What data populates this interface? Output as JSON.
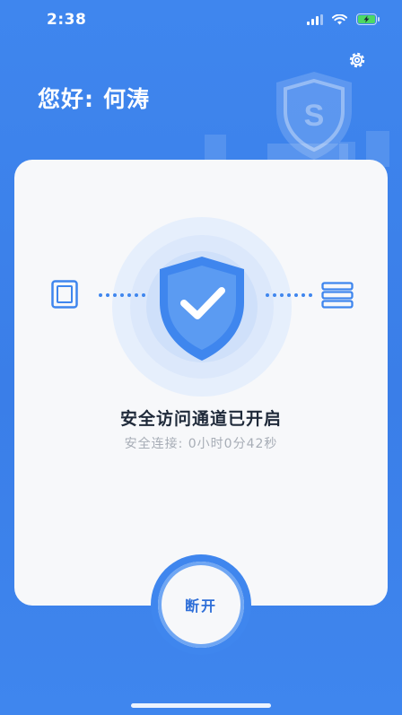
{
  "status_bar": {
    "time": "2:38"
  },
  "header": {
    "greeting": "您好:",
    "user_name": "何涛"
  },
  "icons": {
    "settings": "gear-icon",
    "brand_shield": "shield-s-logo-icon",
    "main_shield": "shield-check-icon",
    "left_device": "tablet-icon",
    "right_device": "server-icon"
  },
  "connection": {
    "title": "安全访问通道已开启",
    "subtitle": "安全连接: 0小时0分42秒"
  },
  "actions": {
    "disconnect_label": "断开"
  },
  "colors": {
    "primary": "#3f86ee",
    "button_text": "#2f6fd8",
    "card_bg": "#f7f8fa"
  }
}
